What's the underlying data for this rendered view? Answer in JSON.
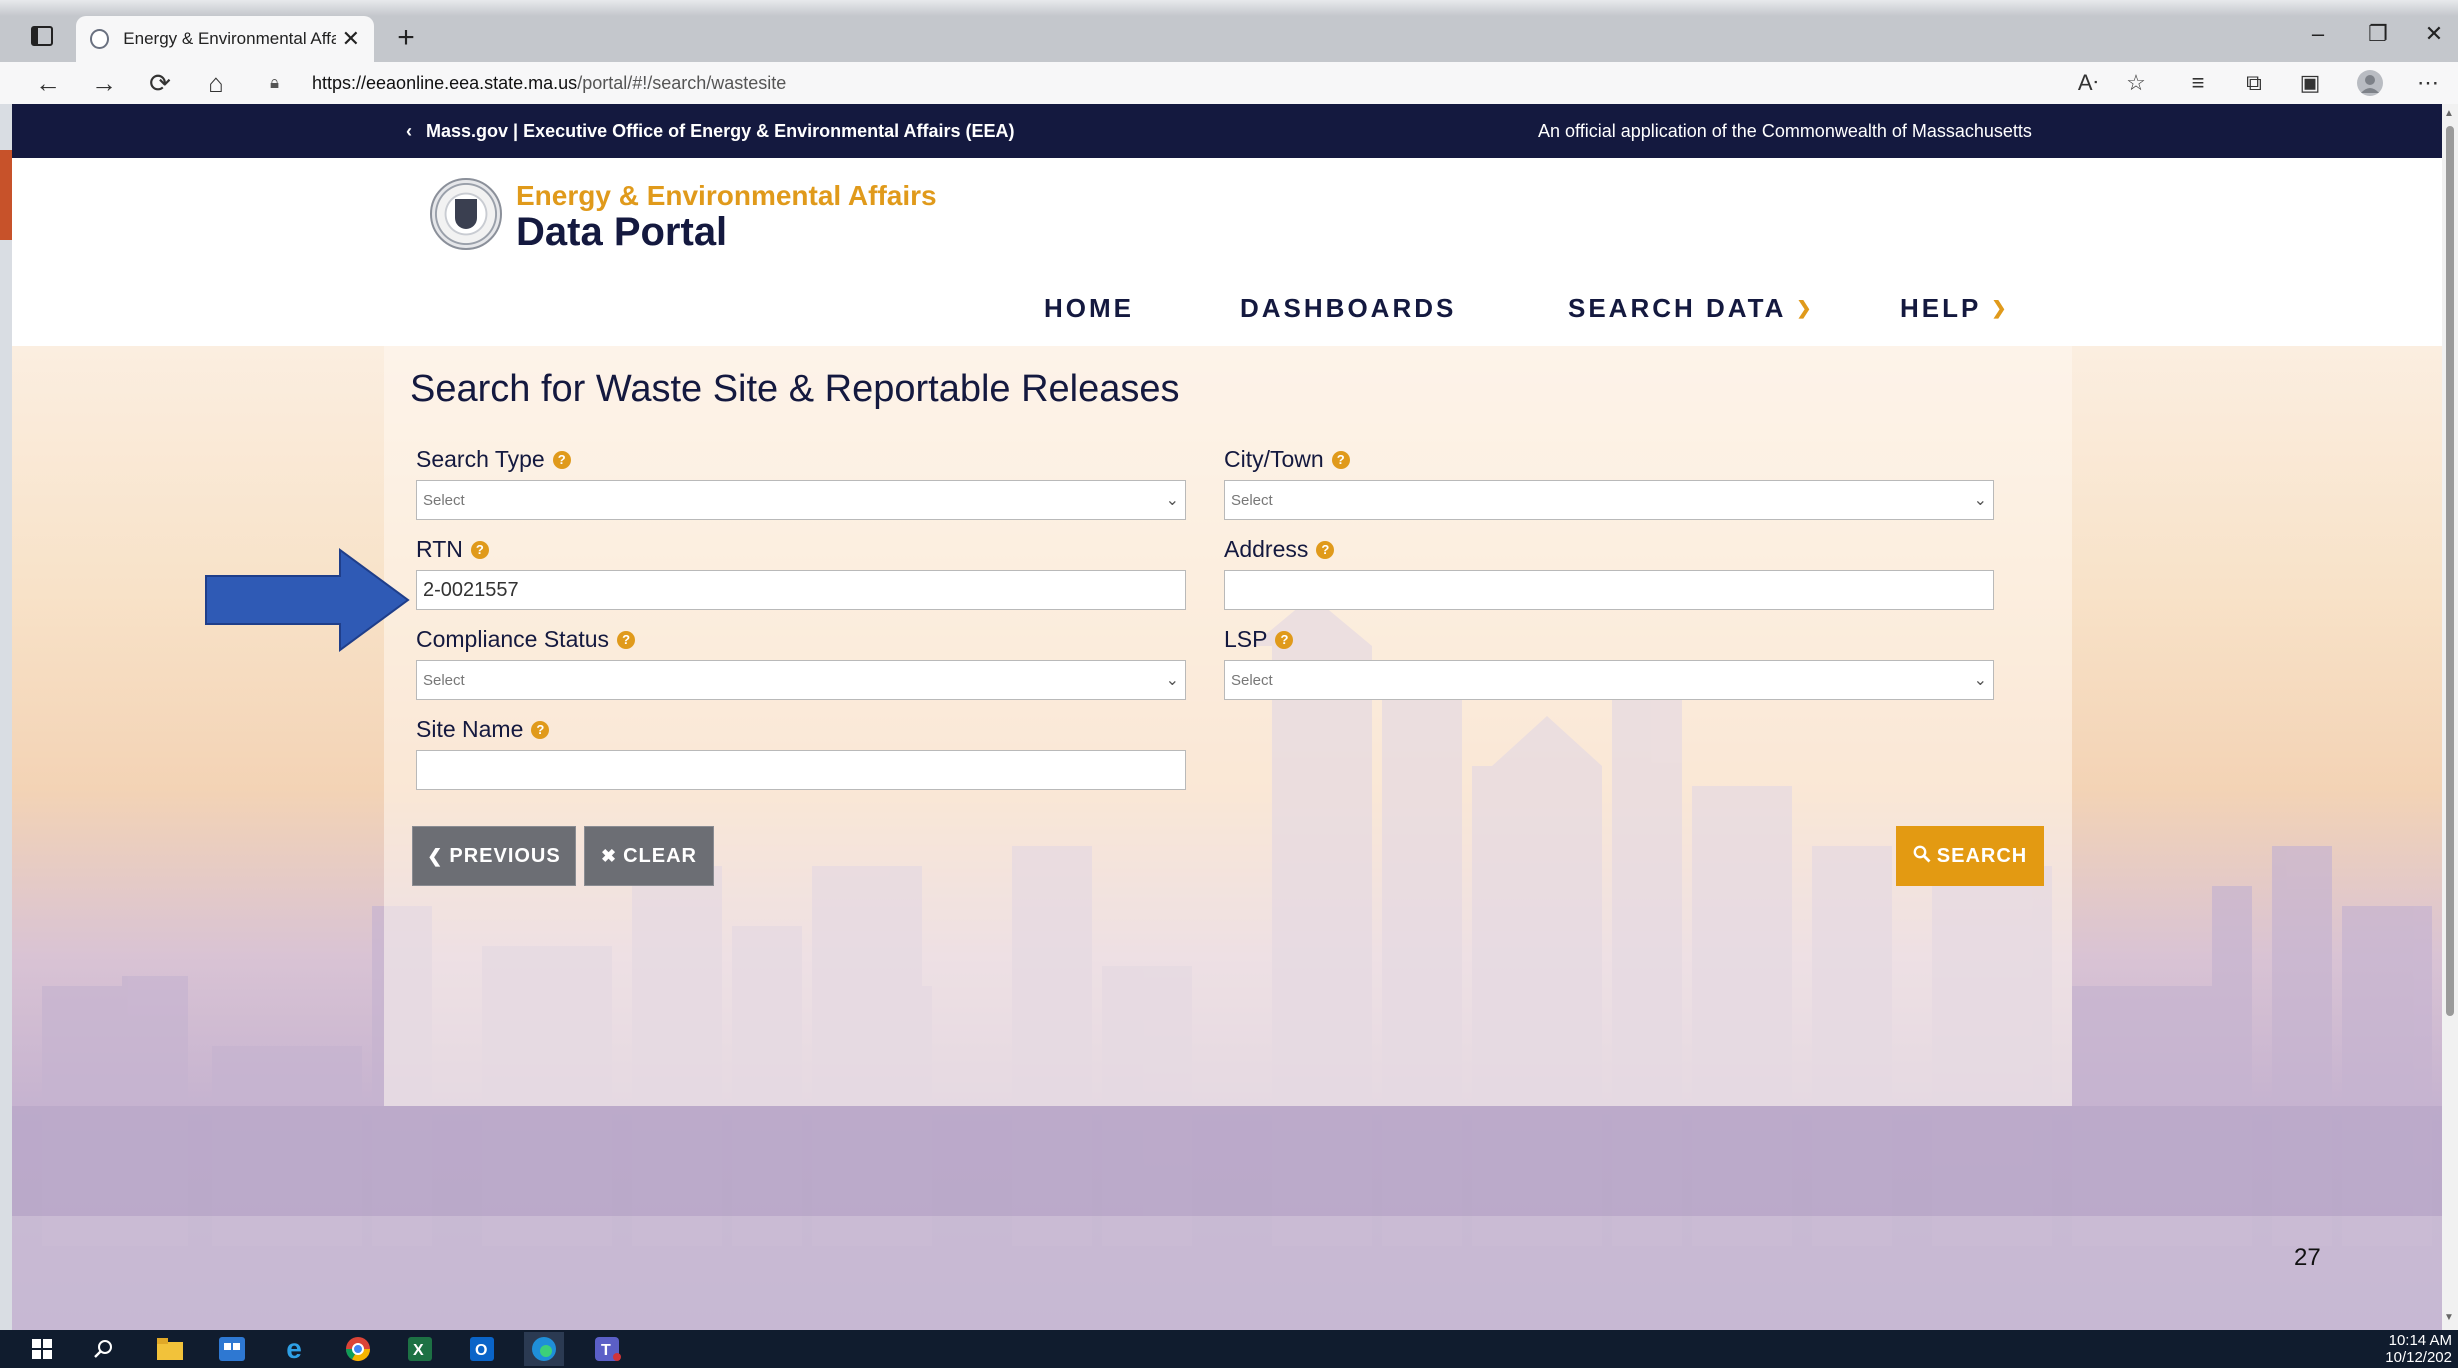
{
  "browser": {
    "tab_title": "Energy & Environmental Affairs D",
    "tab_close": "✕",
    "new_tab": "+",
    "url_host": "https://eeaonline.eea.state.ma.us",
    "url_path": "/portal/#!/search/wastesite",
    "window_controls": [
      "–",
      "❐",
      "✕"
    ],
    "toolbar_icons": [
      "read-aloud-icon",
      "add-favorite-icon",
      "favorites-icon",
      "collections-icon",
      "edge-bar-icon",
      "profile-icon",
      "more-icon"
    ]
  },
  "banner": {
    "left_text": "Mass.gov | Executive Office of Energy & Environmental Affairs (EEA)",
    "right_text": "An official application of the Commonwealth of Massachusetts"
  },
  "brand": {
    "top": "Energy & Environmental Affairs",
    "bottom": "Data Portal"
  },
  "nav": {
    "home": "HOME",
    "dashboards": "DASHBOARDS",
    "search_data": "SEARCH DATA",
    "help": "HELP"
  },
  "form": {
    "title": "Search for Waste Site & Reportable Releases",
    "search_type": {
      "label": "Search Type",
      "value": "Select"
    },
    "city_town": {
      "label": "City/Town",
      "value": "Select"
    },
    "rtn": {
      "label": "RTN",
      "value": "2-0021557"
    },
    "address": {
      "label": "Address",
      "value": ""
    },
    "compliance_status": {
      "label": "Compliance Status",
      "value": "Select"
    },
    "lsp": {
      "label": "LSP",
      "value": "Select"
    },
    "site_name": {
      "label": "Site Name",
      "value": ""
    },
    "help_glyph": "?"
  },
  "buttons": {
    "previous": "PREVIOUS",
    "clear": "CLEAR",
    "search": "SEARCH"
  },
  "slide": {
    "page_number": "27"
  },
  "taskbar": {
    "time": "10:14 AM",
    "date": "10/12/202"
  },
  "colors": {
    "banner": "#14193f",
    "accent": "#e09a1b",
    "arrow": "#2f5ab5"
  }
}
